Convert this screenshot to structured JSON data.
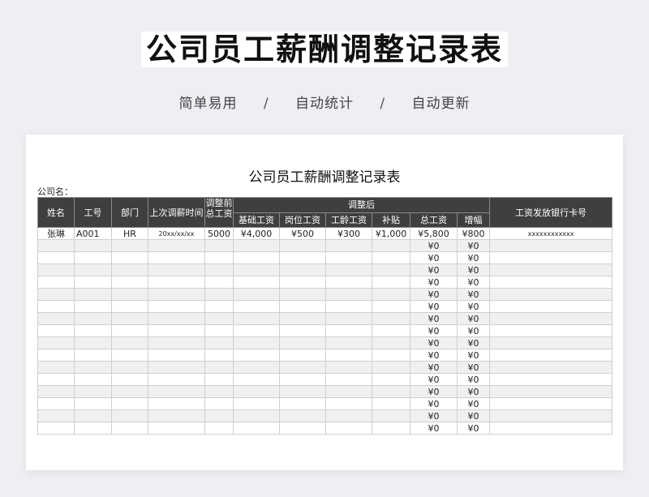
{
  "banner": {
    "title": "公司员工薪酬调整记录表",
    "tags": [
      "简单易用",
      "自动统计",
      "自动更新"
    ],
    "separator": "/"
  },
  "sheet": {
    "title": "公司员工薪酬调整记录表",
    "company_label": "公司名：",
    "headers": {
      "name": "姓名",
      "id": "工号",
      "dept": "部门",
      "last_adjust": "上次调薪时间",
      "before_total": "调整前总工资",
      "after_group": "调整后",
      "base": "基础工资",
      "post": "岗位工资",
      "seniority": "工龄工资",
      "subsidy": "补贴",
      "total": "总工资",
      "increase": "增幅",
      "bank_card": "工资发放银行卡号"
    },
    "rows": [
      {
        "name": "张琳",
        "id": "A001",
        "dept": "HR",
        "last_adjust": "20xx/xx/xx",
        "before_total": "5000",
        "base": "¥4,000",
        "post": "¥500",
        "seniority": "¥300",
        "subsidy": "¥1,000",
        "total": "¥5,800",
        "increase": "¥800",
        "bank_card": "xxxxxxxxxxxx"
      },
      {
        "name": "",
        "id": "",
        "dept": "",
        "last_adjust": "",
        "before_total": "",
        "base": "",
        "post": "",
        "seniority": "",
        "subsidy": "",
        "total": "¥0",
        "increase": "¥0",
        "bank_card": ""
      },
      {
        "name": "",
        "id": "",
        "dept": "",
        "last_adjust": "",
        "before_total": "",
        "base": "",
        "post": "",
        "seniority": "",
        "subsidy": "",
        "total": "¥0",
        "increase": "¥0",
        "bank_card": ""
      },
      {
        "name": "",
        "id": "",
        "dept": "",
        "last_adjust": "",
        "before_total": "",
        "base": "",
        "post": "",
        "seniority": "",
        "subsidy": "",
        "total": "¥0",
        "increase": "¥0",
        "bank_card": ""
      },
      {
        "name": "",
        "id": "",
        "dept": "",
        "last_adjust": "",
        "before_total": "",
        "base": "",
        "post": "",
        "seniority": "",
        "subsidy": "",
        "total": "¥0",
        "increase": "¥0",
        "bank_card": ""
      },
      {
        "name": "",
        "id": "",
        "dept": "",
        "last_adjust": "",
        "before_total": "",
        "base": "",
        "post": "",
        "seniority": "",
        "subsidy": "",
        "total": "¥0",
        "increase": "¥0",
        "bank_card": ""
      },
      {
        "name": "",
        "id": "",
        "dept": "",
        "last_adjust": "",
        "before_total": "",
        "base": "",
        "post": "",
        "seniority": "",
        "subsidy": "",
        "total": "¥0",
        "increase": "¥0",
        "bank_card": ""
      },
      {
        "name": "",
        "id": "",
        "dept": "",
        "last_adjust": "",
        "before_total": "",
        "base": "",
        "post": "",
        "seniority": "",
        "subsidy": "",
        "total": "¥0",
        "increase": "¥0",
        "bank_card": ""
      },
      {
        "name": "",
        "id": "",
        "dept": "",
        "last_adjust": "",
        "before_total": "",
        "base": "",
        "post": "",
        "seniority": "",
        "subsidy": "",
        "total": "¥0",
        "increase": "¥0",
        "bank_card": ""
      },
      {
        "name": "",
        "id": "",
        "dept": "",
        "last_adjust": "",
        "before_total": "",
        "base": "",
        "post": "",
        "seniority": "",
        "subsidy": "",
        "total": "¥0",
        "increase": "¥0",
        "bank_card": ""
      },
      {
        "name": "",
        "id": "",
        "dept": "",
        "last_adjust": "",
        "before_total": "",
        "base": "",
        "post": "",
        "seniority": "",
        "subsidy": "",
        "total": "¥0",
        "increase": "¥0",
        "bank_card": ""
      },
      {
        "name": "",
        "id": "",
        "dept": "",
        "last_adjust": "",
        "before_total": "",
        "base": "",
        "post": "",
        "seniority": "",
        "subsidy": "",
        "total": "¥0",
        "increase": "¥0",
        "bank_card": ""
      },
      {
        "name": "",
        "id": "",
        "dept": "",
        "last_adjust": "",
        "before_total": "",
        "base": "",
        "post": "",
        "seniority": "",
        "subsidy": "",
        "total": "¥0",
        "increase": "¥0",
        "bank_card": ""
      },
      {
        "name": "",
        "id": "",
        "dept": "",
        "last_adjust": "",
        "before_total": "",
        "base": "",
        "post": "",
        "seniority": "",
        "subsidy": "",
        "total": "¥0",
        "increase": "¥0",
        "bank_card": ""
      },
      {
        "name": "",
        "id": "",
        "dept": "",
        "last_adjust": "",
        "before_total": "",
        "base": "",
        "post": "",
        "seniority": "",
        "subsidy": "",
        "total": "¥0",
        "increase": "¥0",
        "bank_card": ""
      },
      {
        "name": "",
        "id": "",
        "dept": "",
        "last_adjust": "",
        "before_total": "",
        "base": "",
        "post": "",
        "seniority": "",
        "subsidy": "",
        "total": "¥0",
        "increase": "¥0",
        "bank_card": ""
      },
      {
        "name": "",
        "id": "",
        "dept": "",
        "last_adjust": "",
        "before_total": "",
        "base": "",
        "post": "",
        "seniority": "",
        "subsidy": "",
        "total": "¥0",
        "increase": "¥0",
        "bank_card": ""
      }
    ]
  }
}
